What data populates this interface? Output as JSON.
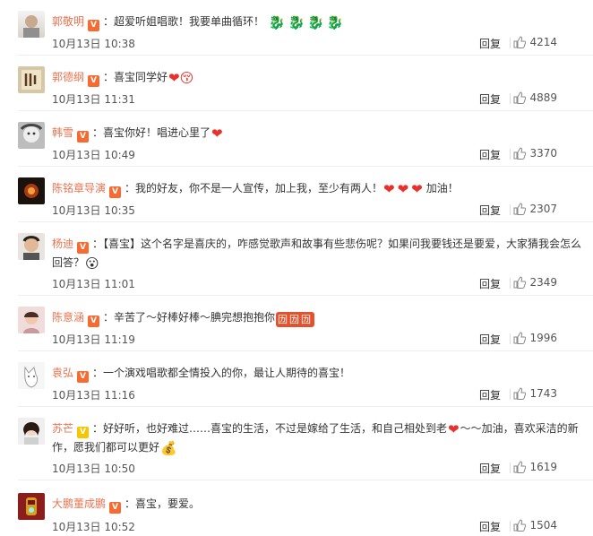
{
  "comments": [
    {
      "name": "郭敬明",
      "badge": "orange",
      "text": "超爱听姐唱歌！我要单曲循环！",
      "emoji": "🐉🐉🐉🐉",
      "time": "10月13日 10:38",
      "reply": "回复",
      "likes": "4214"
    },
    {
      "name": "郭德纲",
      "badge": "orange",
      "text": "喜宝同学好",
      "emoji": "❤😚",
      "time": "10月13日 11:31",
      "reply": "回复",
      "likes": "4889"
    },
    {
      "name": "韩雪",
      "badge": "orange",
      "text": "喜宝你好！唱进心里了",
      "emoji": "❤",
      "time": "10月13日 10:49",
      "reply": "回复",
      "likes": "3370"
    },
    {
      "name": "陈铭章导演",
      "badge": "orange",
      "text": "我的好友，你不是一人宣传，加上我，至少有两人！",
      "emoji": "❤❤❤",
      "text2": "加油！",
      "time": "10月13日 10:35",
      "reply": "回复",
      "likes": "2307"
    },
    {
      "name": "杨迪",
      "badge": "orange",
      "text": "【喜宝】这个名字是喜庆的，咋感觉歌声和故事有些悲伤呢？如果问我要钱还是要爱，大家猜我会怎么回答？",
      "emoji": "😮",
      "time": "10月13日 11:01",
      "reply": "回复",
      "likes": "2349"
    },
    {
      "name": "陈意涵",
      "badge": "orange",
      "text": "辛苦了～好棒好棒～腆完想抱抱你",
      "emoji": "㘞㘞㘞",
      "time": "10月13日 11:19",
      "reply": "回复",
      "likes": "1996"
    },
    {
      "name": "袁弘",
      "badge": "orange",
      "text": "一个演戏唱歌都全情投入的你，最让人期待的喜宝！",
      "emoji": "",
      "time": "10月13日 11:16",
      "reply": "回复",
      "likes": "1743"
    },
    {
      "name": "苏芒",
      "badge": "gold",
      "text": "好好听，也好难过……喜宝的生活，不过是嫁给了生活，和自己相处到老",
      "emoji": "❤",
      "text2": "～～加油，喜欢采洁的新作，愿我们都可以更好",
      "emoji2": "💰",
      "time": "10月13日 10:50",
      "reply": "回复",
      "likes": "1619"
    },
    {
      "name": "大鹏董成鹏",
      "badge": "orange",
      "text": "喜宝，要爱。",
      "emoji": "",
      "time": "10月13日 10:52",
      "reply": "回复",
      "likes": "1504"
    }
  ]
}
